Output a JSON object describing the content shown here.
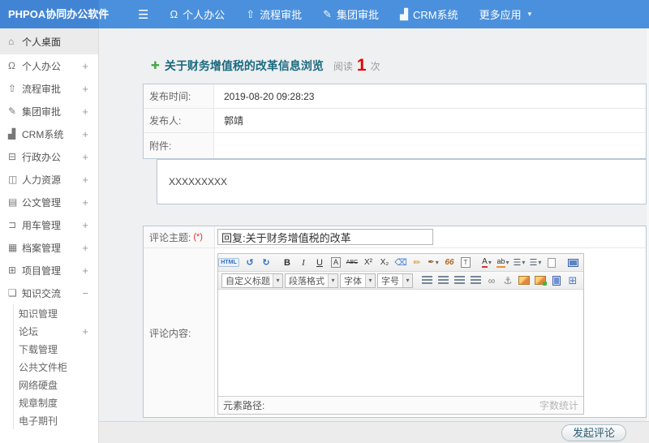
{
  "header": {
    "logo": "PHPOA协同办公软件",
    "hamburger_icon": "☰",
    "nav": [
      {
        "label": "个人办公",
        "icon": "Ω"
      },
      {
        "label": "流程审批",
        "icon": "⇧"
      },
      {
        "label": "集团审批",
        "icon": "✎"
      },
      {
        "label": "CRM系统",
        "icon": "▟"
      },
      {
        "label": "更多应用",
        "icon": "",
        "caret": "▾"
      }
    ]
  },
  "sidebar": {
    "items": [
      {
        "label": "个人桌面",
        "icon": "⌂",
        "mark": ""
      },
      {
        "label": "个人办公",
        "icon": "Ω",
        "mark": "+"
      },
      {
        "label": "流程审批",
        "icon": "⇧",
        "mark": "+"
      },
      {
        "label": "集团审批",
        "icon": "✎",
        "mark": "+"
      },
      {
        "label": "CRM系统",
        "icon": "▟",
        "mark": "+"
      },
      {
        "label": "行政办公",
        "icon": "⊟",
        "mark": "+"
      },
      {
        "label": "人力资源",
        "icon": "◫",
        "mark": "+"
      },
      {
        "label": "公文管理",
        "icon": "▤",
        "mark": "+"
      },
      {
        "label": "用车管理",
        "icon": "⊐",
        "mark": "+"
      },
      {
        "label": "档案管理",
        "icon": "▦",
        "mark": "+"
      },
      {
        "label": "项目管理",
        "icon": "⊞",
        "mark": "+"
      },
      {
        "label": "知识交流",
        "icon": "❏",
        "mark": "−"
      }
    ],
    "sub": [
      {
        "label": "知识管理",
        "mark": ""
      },
      {
        "label": "论坛",
        "mark": "+"
      },
      {
        "label": "下载管理",
        "mark": ""
      },
      {
        "label": "公共文件柜",
        "mark": ""
      },
      {
        "label": "网络硬盘",
        "mark": ""
      },
      {
        "label": "规章制度",
        "mark": ""
      },
      {
        "label": "电子期刊",
        "mark": ""
      }
    ]
  },
  "page": {
    "plus_icon": "✚",
    "title": "关于财务增值税的改革信息浏览",
    "read_label": "阅读",
    "read_count": "1",
    "read_unit": "次"
  },
  "info": {
    "rows": [
      {
        "label": "发布时间:",
        "value": "2019-08-20 09:28:23"
      },
      {
        "label": "发布人:",
        "value": "郭靖"
      },
      {
        "label": "附件:",
        "value": ""
      }
    ],
    "content": "XXXXXXXXX"
  },
  "form": {
    "subject_label": "评论主题:",
    "required_mark": "(*)",
    "subject_value": "回复:关于财务增值税的改革",
    "content_label": "评论内容:",
    "submit_label": "发起评论"
  },
  "editor": {
    "row1": [
      {
        "name": "html-source",
        "glyph": "HTML"
      },
      {
        "name": "undo",
        "glyph": "↺"
      },
      {
        "name": "redo",
        "glyph": "↻"
      },
      {
        "name": "bold",
        "glyph": "B"
      },
      {
        "name": "italic",
        "glyph": "I"
      },
      {
        "name": "underline",
        "glyph": "U"
      },
      {
        "name": "font-frame",
        "glyph": "A"
      },
      {
        "name": "strikethrough",
        "glyph": "ABC"
      },
      {
        "name": "superscript",
        "glyph": "X²"
      },
      {
        "name": "subscript",
        "glyph": "X₂"
      },
      {
        "name": "eraser",
        "glyph": "⌫"
      },
      {
        "name": "clean-format",
        "glyph": "✏"
      },
      {
        "name": "format-paint",
        "glyph": "✒"
      },
      {
        "name": "blockquote",
        "glyph": "66"
      },
      {
        "name": "paste-text",
        "glyph": "T"
      },
      {
        "name": "font-color",
        "glyph": "A"
      },
      {
        "name": "highlight-color",
        "glyph": "ab"
      },
      {
        "name": "ordered-list",
        "glyph": "☰"
      },
      {
        "name": "unordered-list",
        "glyph": "☰"
      },
      {
        "name": "link",
        "glyph": "∞"
      },
      {
        "name": "anchor",
        "glyph": "⚓"
      },
      {
        "name": "table",
        "glyph": "⊞"
      }
    ],
    "selects": [
      {
        "label": "自定义标题"
      },
      {
        "label": "段落格式"
      },
      {
        "label": "字体"
      },
      {
        "label": "字号"
      }
    ],
    "path_label": "元素路径:",
    "count_label": "字数统计"
  }
}
